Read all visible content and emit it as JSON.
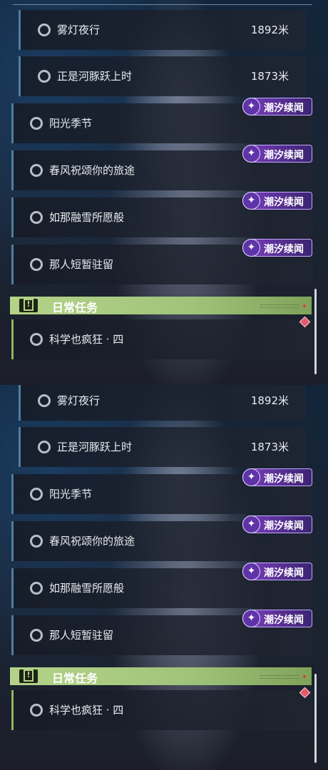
{
  "quests": {
    "sub": [
      {
        "title": "雾灯夜行",
        "distance": "1892米"
      },
      {
        "title": "正是河豚跃上时",
        "distance": "1873米"
      }
    ],
    "main": [
      {
        "title": "阳光季节",
        "tag": "潮汐续闻"
      },
      {
        "title": "春风祝颂你的旅途",
        "tag": "潮汐续闻"
      },
      {
        "title": "如那融雪所愿般",
        "tag": "潮汐续闻"
      },
      {
        "title": "那人短暂驻留",
        "tag": "潮汐续闻"
      }
    ]
  },
  "daily": {
    "header": "日常任务",
    "items": [
      {
        "title": "科学也疯狂 · 四"
      }
    ]
  },
  "icons": {
    "quest_status": "circle-icon",
    "tag": "sparkle-icon",
    "daily": "alert-icon",
    "marker": "diamond-marker-icon"
  },
  "colors": {
    "daily_accent": "#b4d389",
    "tag_purple": "#7c3fbf",
    "marker_red": "#e25a6a"
  }
}
